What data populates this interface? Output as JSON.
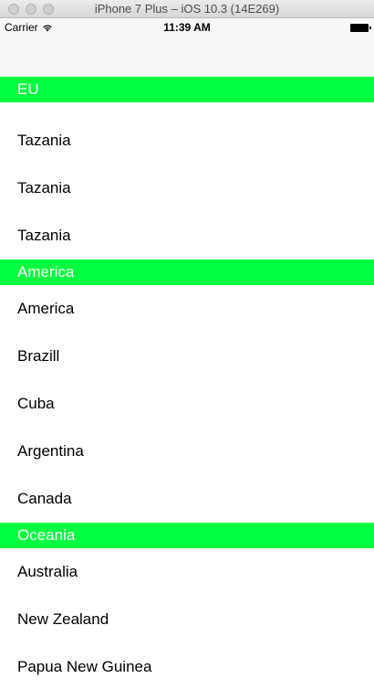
{
  "window": {
    "title": "iPhone 7 Plus – iOS 10.3 (14E269)"
  },
  "status_bar": {
    "carrier": "Carrier",
    "time": "11:39 AM"
  },
  "table": {
    "scrolled_ghost_row": "Tazania",
    "sections": [
      {
        "header": "EU",
        "rows": [
          "Tazania",
          "Tazania",
          "Tazania"
        ]
      },
      {
        "header": "America",
        "rows": [
          "America",
          "Brazill",
          "Cuba",
          "Argentina",
          "Canada"
        ]
      },
      {
        "header": "Oceania",
        "rows": [
          "Australia",
          "New Zealand",
          "Papua New Guinea"
        ]
      }
    ]
  },
  "colors": {
    "section_header_bg": "#00ff40",
    "section_header_text": "#ffffff"
  }
}
